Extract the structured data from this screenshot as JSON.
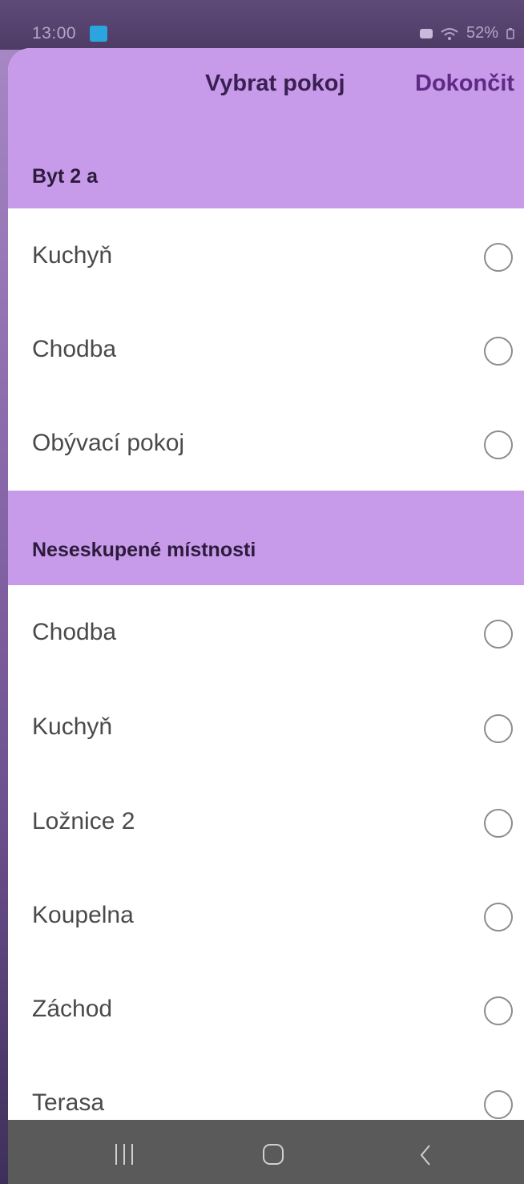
{
  "status_bar": {
    "time": "13:00",
    "battery": "52%"
  },
  "header": {
    "title": "Vybrat pokoj",
    "done_label": "Dokončit"
  },
  "sections": [
    {
      "title": "Byt 2 a",
      "rooms": [
        "Kuchyň",
        "Chodba",
        "Obývací pokoj"
      ]
    },
    {
      "title": "Neseskupené místnosti",
      "rooms": [
        "Chodba",
        "Kuchyň",
        "Ložnice 2",
        "Koupelna",
        "Záchod",
        "Terasa"
      ]
    }
  ],
  "colors": {
    "header_bg": "#c79bea",
    "accent_text": "#5e2a85"
  },
  "icons": {
    "radio": "radio-unselected-icon",
    "nav": [
      "recent-apps-icon",
      "home-icon",
      "back-icon"
    ]
  }
}
